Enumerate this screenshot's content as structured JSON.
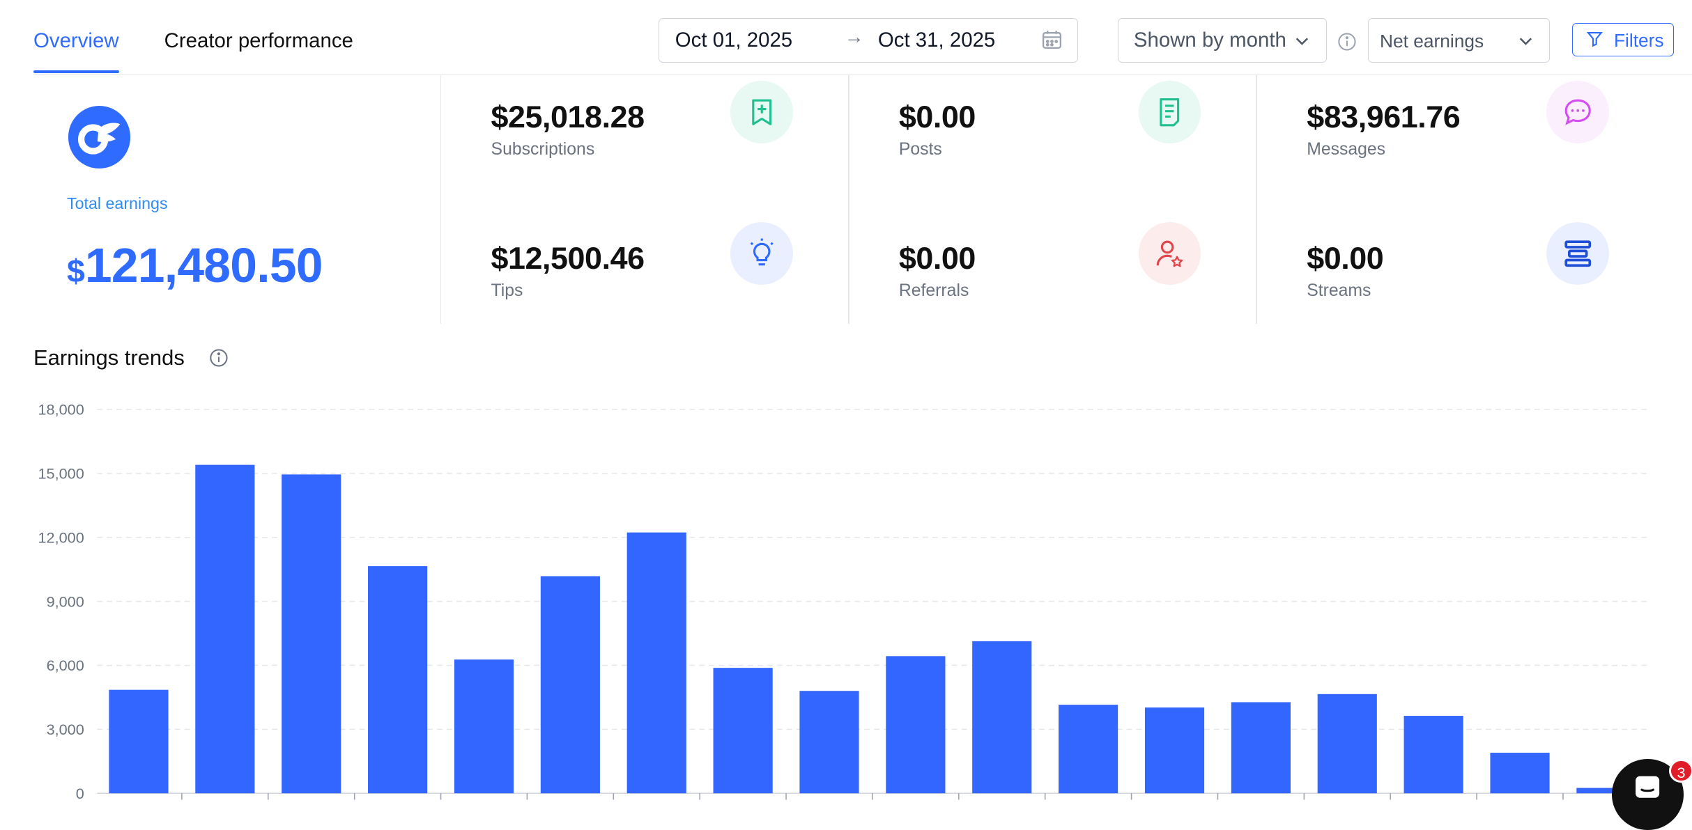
{
  "tabs": [
    {
      "label": "Overview",
      "active": true
    },
    {
      "label": "Creator performance",
      "active": false
    }
  ],
  "date_range": {
    "start": "Oct 01, 2025",
    "arrow": "→",
    "end": "Oct 31, 2025"
  },
  "shown_by": "Shown by month",
  "earnings_type": "Net earnings",
  "filters_label": "Filters",
  "total": {
    "label": "Total earnings",
    "currency": "$",
    "value": "121,480.50"
  },
  "stats": {
    "subscriptions": {
      "value": "$25,018.28",
      "label": "Subscriptions",
      "icon": "bookmark-plus-icon",
      "color": "#1fbf8f",
      "bg": "#e8f8f2"
    },
    "posts": {
      "value": "$0.00",
      "label": "Posts",
      "icon": "document-icon",
      "color": "#1fbf8f",
      "bg": "#e8f8f2"
    },
    "messages": {
      "value": "$83,961.76",
      "label": "Messages",
      "icon": "chat-bubble-icon",
      "color": "#d34ef0",
      "bg": "#fbeefd"
    },
    "tips": {
      "value": "$12,500.46",
      "label": "Tips",
      "icon": "lightbulb-icon",
      "color": "#2f6bff",
      "bg": "#e9efff"
    },
    "referrals": {
      "value": "$0.00",
      "label": "Referrals",
      "icon": "user-star-icon",
      "color": "#e0454b",
      "bg": "#fdecec"
    },
    "streams": {
      "value": "$0.00",
      "label": "Streams",
      "icon": "streams-bars-icon",
      "color": "#1f4fd6",
      "bg": "#e9efff"
    }
  },
  "section_title": "Earnings trends",
  "notification_count": "3",
  "colors": {
    "accent": "#2f6bff",
    "bar": "#3366ff"
  },
  "chart_data": {
    "type": "bar",
    "title": "",
    "xlabel": "",
    "ylabel": "",
    "ylim": [
      0,
      18000
    ],
    "yticks": [
      0,
      3000,
      6000,
      9000,
      12000,
      15000,
      18000
    ],
    "ytick_labels": [
      "0",
      "3,000",
      "6,000",
      "9,000",
      "12,000",
      "15,000",
      "18,000"
    ],
    "grid": true,
    "values": [
      4850,
      15400,
      14950,
      10650,
      6270,
      10180,
      12230,
      5880,
      4800,
      6430,
      7130,
      4150,
      4020,
      4270,
      4650,
      3630,
      1900,
      250
    ]
  }
}
